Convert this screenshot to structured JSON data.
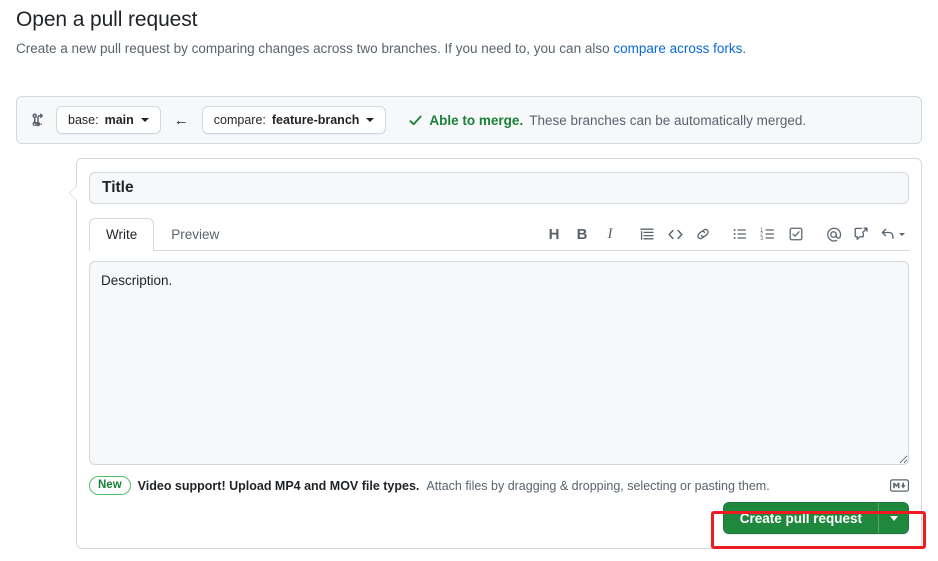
{
  "header": {
    "title": "Open a pull request",
    "subtitle_before": "Create a new pull request by comparing changes across two branches. If you need to, you can also ",
    "subtitle_link": "compare across forks",
    "subtitle_after": "."
  },
  "compare_bar": {
    "icon": "git-compare-icon",
    "base": {
      "prefix": "base:",
      "branch": "main"
    },
    "direction_arrow": "←",
    "compare": {
      "prefix": "compare:",
      "branch": "feature-branch"
    },
    "status": {
      "check_icon": "check-icon",
      "strong": "Able to merge.",
      "rest": "These branches can be automatically merged.",
      "color": "#1a7f37"
    }
  },
  "form": {
    "title_field": {
      "value": "",
      "placeholder": "Title"
    },
    "tabs": [
      {
        "label": "Write",
        "active": true
      },
      {
        "label": "Preview",
        "active": false
      }
    ],
    "toolbar": [
      {
        "name": "heading-icon",
        "glyph": "H",
        "kind": "letter"
      },
      {
        "name": "bold-icon",
        "glyph": "B",
        "kind": "letter"
      },
      {
        "name": "italic-icon",
        "glyph": "I",
        "kind": "letter-i"
      },
      {
        "name": "quote-icon",
        "glyph": "",
        "kind": "svg"
      },
      {
        "name": "code-icon",
        "glyph": "",
        "kind": "svg"
      },
      {
        "name": "link-icon",
        "glyph": "",
        "kind": "svg"
      },
      {
        "name": "unordered-list-icon",
        "glyph": "",
        "kind": "svg"
      },
      {
        "name": "ordered-list-icon",
        "glyph": "",
        "kind": "svg"
      },
      {
        "name": "task-list-icon",
        "glyph": "",
        "kind": "svg"
      },
      {
        "name": "mention-icon",
        "glyph": "@",
        "kind": "svg"
      },
      {
        "name": "reference-icon",
        "glyph": "",
        "kind": "svg"
      },
      {
        "name": "saved-replies-icon",
        "glyph": "",
        "kind": "svg"
      }
    ],
    "description_field": {
      "value": "",
      "placeholder": "Description."
    },
    "footer": {
      "badge": "New",
      "note_bold": "Video support! Upload MP4 and MOV file types.",
      "note_rest": "Attach files by dragging & dropping, selecting or pasting them.",
      "markdown_icon": "markdown-icon"
    },
    "submit": {
      "label": "Create pull request",
      "dropdown_icon": "chevron-down-icon",
      "color": "#1f883d"
    }
  },
  "annotation": {
    "highlight_target": "create-pull-request-button",
    "color": "#ee1b22"
  }
}
